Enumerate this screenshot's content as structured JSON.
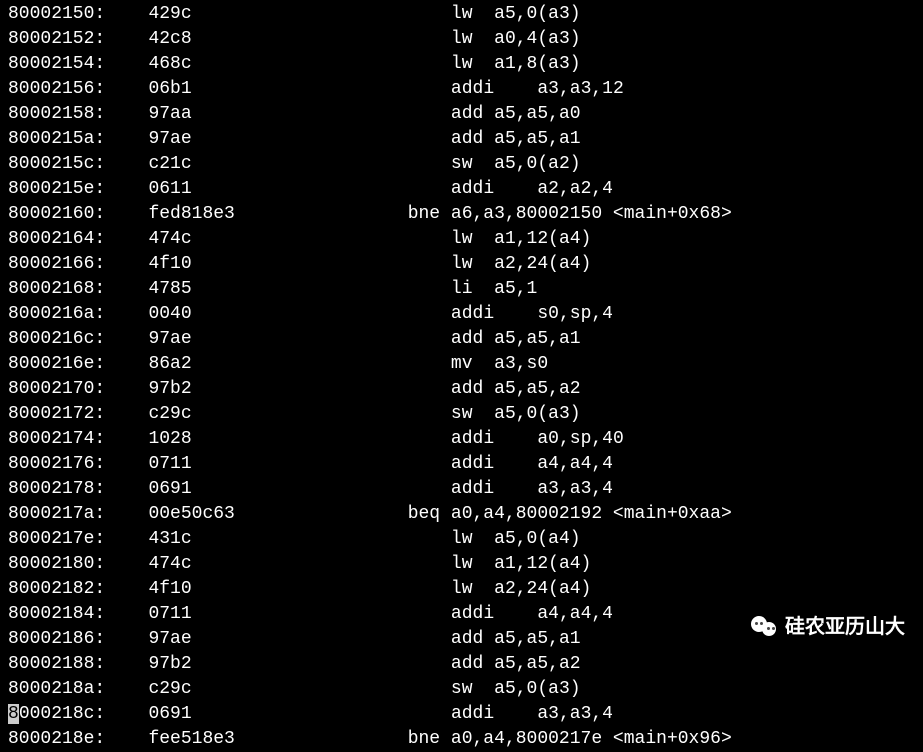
{
  "watermark": {
    "text": "硅农亚历山大"
  },
  "disassembly": [
    {
      "addr": "80002150:",
      "hex": "429c",
      "indent2": "    ",
      "mnemonic": "lw",
      "pad": "  ",
      "operands": "a5,0(a3)"
    },
    {
      "addr": "80002152:",
      "hex": "42c8",
      "indent2": "    ",
      "mnemonic": "lw",
      "pad": "  ",
      "operands": "a0,4(a3)"
    },
    {
      "addr": "80002154:",
      "hex": "468c",
      "indent2": "    ",
      "mnemonic": "lw",
      "pad": "  ",
      "operands": "a1,8(a3)"
    },
    {
      "addr": "80002156:",
      "hex": "06b1",
      "indent2": "    ",
      "mnemonic": "addi",
      "pad": "    ",
      "operands": "a3,a3,12"
    },
    {
      "addr": "80002158:",
      "hex": "97aa",
      "indent2": "    ",
      "mnemonic": "add",
      "pad": " ",
      "operands": "a5,a5,a0"
    },
    {
      "addr": "8000215a:",
      "hex": "97ae",
      "indent2": "    ",
      "mnemonic": "add",
      "pad": " ",
      "operands": "a5,a5,a1"
    },
    {
      "addr": "8000215c:",
      "hex": "c21c",
      "indent2": "    ",
      "mnemonic": "sw",
      "pad": "  ",
      "operands": "a5,0(a2)"
    },
    {
      "addr": "8000215e:",
      "hex": "0611",
      "indent2": "    ",
      "mnemonic": "addi",
      "pad": "    ",
      "operands": "a2,a2,4"
    },
    {
      "addr": "80002160:",
      "hex": "fed818e3",
      "indent2": "",
      "mnemonic": "bne",
      "pad": " ",
      "operands": "a6,a3,80002150 <main+0x68>"
    },
    {
      "addr": "80002164:",
      "hex": "474c",
      "indent2": "    ",
      "mnemonic": "lw",
      "pad": "  ",
      "operands": "a1,12(a4)"
    },
    {
      "addr": "80002166:",
      "hex": "4f10",
      "indent2": "    ",
      "mnemonic": "lw",
      "pad": "  ",
      "operands": "a2,24(a4)"
    },
    {
      "addr": "80002168:",
      "hex": "4785",
      "indent2": "    ",
      "mnemonic": "li",
      "pad": "  ",
      "operands": "a5,1"
    },
    {
      "addr": "8000216a:",
      "hex": "0040",
      "indent2": "    ",
      "mnemonic": "addi",
      "pad": "    ",
      "operands": "s0,sp,4"
    },
    {
      "addr": "8000216c:",
      "hex": "97ae",
      "indent2": "    ",
      "mnemonic": "add",
      "pad": " ",
      "operands": "a5,a5,a1"
    },
    {
      "addr": "8000216e:",
      "hex": "86a2",
      "indent2": "    ",
      "mnemonic": "mv",
      "pad": "  ",
      "operands": "a3,s0"
    },
    {
      "addr": "80002170:",
      "hex": "97b2",
      "indent2": "    ",
      "mnemonic": "add",
      "pad": " ",
      "operands": "a5,a5,a2"
    },
    {
      "addr": "80002172:",
      "hex": "c29c",
      "indent2": "    ",
      "mnemonic": "sw",
      "pad": "  ",
      "operands": "a5,0(a3)"
    },
    {
      "addr": "80002174:",
      "hex": "1028",
      "indent2": "    ",
      "mnemonic": "addi",
      "pad": "    ",
      "operands": "a0,sp,40"
    },
    {
      "addr": "80002176:",
      "hex": "0711",
      "indent2": "    ",
      "mnemonic": "addi",
      "pad": "    ",
      "operands": "a4,a4,4"
    },
    {
      "addr": "80002178:",
      "hex": "0691",
      "indent2": "    ",
      "mnemonic": "addi",
      "pad": "    ",
      "operands": "a3,a3,4"
    },
    {
      "addr": "8000217a:",
      "hex": "00e50c63",
      "indent2": "",
      "mnemonic": "beq",
      "pad": " ",
      "operands": "a0,a4,80002192 <main+0xaa>"
    },
    {
      "addr": "8000217e:",
      "hex": "431c",
      "indent2": "    ",
      "mnemonic": "lw",
      "pad": "  ",
      "operands": "a5,0(a4)"
    },
    {
      "addr": "80002180:",
      "hex": "474c",
      "indent2": "    ",
      "mnemonic": "lw",
      "pad": "  ",
      "operands": "a1,12(a4)"
    },
    {
      "addr": "80002182:",
      "hex": "4f10",
      "indent2": "    ",
      "mnemonic": "lw",
      "pad": "  ",
      "operands": "a2,24(a4)"
    },
    {
      "addr": "80002184:",
      "hex": "0711",
      "indent2": "    ",
      "mnemonic": "addi",
      "pad": "    ",
      "operands": "a4,a4,4"
    },
    {
      "addr": "80002186:",
      "hex": "97ae",
      "indent2": "    ",
      "mnemonic": "add",
      "pad": " ",
      "operands": "a5,a5,a1"
    },
    {
      "addr": "80002188:",
      "hex": "97b2",
      "indent2": "    ",
      "mnemonic": "add",
      "pad": " ",
      "operands": "a5,a5,a2"
    },
    {
      "addr": "8000218a:",
      "hex": "c29c",
      "indent2": "    ",
      "mnemonic": "sw",
      "pad": "  ",
      "operands": "a5,0(a3)"
    },
    {
      "addr": "8000218c:",
      "hex": "0691",
      "indent2": "    ",
      "mnemonic": "addi",
      "pad": "    ",
      "operands": "a3,a3,4",
      "cursor": true
    },
    {
      "addr": "8000218e:",
      "hex": "fee518e3",
      "indent2": "",
      "mnemonic": "bne",
      "pad": " ",
      "operands": "a0,a4,8000217e <main+0x96>"
    }
  ]
}
